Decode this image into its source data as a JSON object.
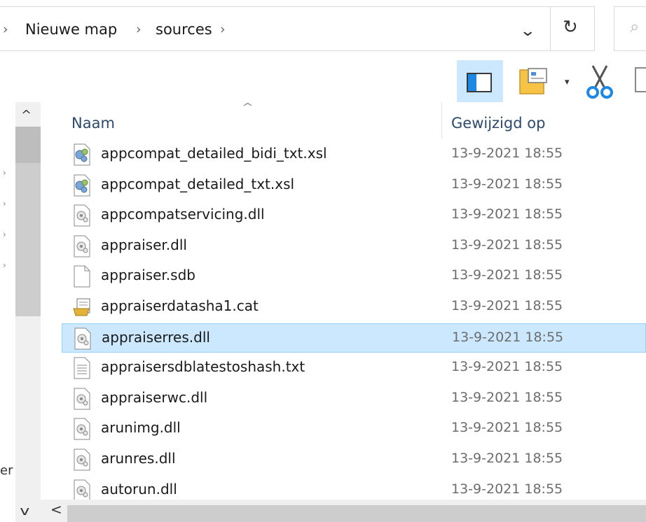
{
  "breadcrumb": {
    "items": [
      "Nieuwe map",
      "sources"
    ],
    "sep": "›"
  },
  "addressbar": {
    "dropdown_glyph": "⌄",
    "refresh_glyph": "↻",
    "search_glyph": "⌕"
  },
  "toolbar": {
    "dropdown_glyph": "▾"
  },
  "columns": {
    "name": "Naam",
    "date": "Gewijzigd op",
    "sort_glyph": "^"
  },
  "nav": {
    "up_glyph": "^",
    "down_glyph": "v",
    "partial_label": "er",
    "chevron": "›"
  },
  "hscroll": {
    "left_glyph": "<"
  },
  "files": [
    {
      "name": "appcompat_detailed_bidi_txt.xsl",
      "date": "13-9-2021 18:55",
      "icon": "xsl-icon",
      "selected": false
    },
    {
      "name": "appcompat_detailed_txt.xsl",
      "date": "13-9-2021 18:55",
      "icon": "xsl-icon",
      "selected": false
    },
    {
      "name": "appcompatservicing.dll",
      "date": "13-9-2021 18:55",
      "icon": "dll-icon",
      "selected": false
    },
    {
      "name": "appraiser.dll",
      "date": "13-9-2021 18:55",
      "icon": "dll-icon",
      "selected": false
    },
    {
      "name": "appraiser.sdb",
      "date": "13-9-2021 18:55",
      "icon": "blank-file-icon",
      "selected": false
    },
    {
      "name": "appraiserdatasha1.cat",
      "date": "13-9-2021 18:55",
      "icon": "cat-icon",
      "selected": false
    },
    {
      "name": "appraiserres.dll",
      "date": "13-9-2021 18:55",
      "icon": "dll-icon",
      "selected": true
    },
    {
      "name": "appraisersdblatestoshash.txt",
      "date": "13-9-2021 18:55",
      "icon": "text-file-icon",
      "selected": false
    },
    {
      "name": "appraiserwc.dll",
      "date": "13-9-2021 18:55",
      "icon": "dll-icon",
      "selected": false
    },
    {
      "name": "arunimg.dll",
      "date": "13-9-2021 18:55",
      "icon": "dll-icon",
      "selected": false
    },
    {
      "name": "arunres.dll",
      "date": "13-9-2021 18:55",
      "icon": "dll-icon",
      "selected": false
    },
    {
      "name": "autorun.dll",
      "date": "13-9-2021 18:55",
      "icon": "dll-icon",
      "selected": false
    }
  ],
  "colors": {
    "selection": "#cce8ff",
    "selection_border": "#99d1ff",
    "header_text": "#2b4a6e",
    "date_text": "#6d6d6d"
  }
}
